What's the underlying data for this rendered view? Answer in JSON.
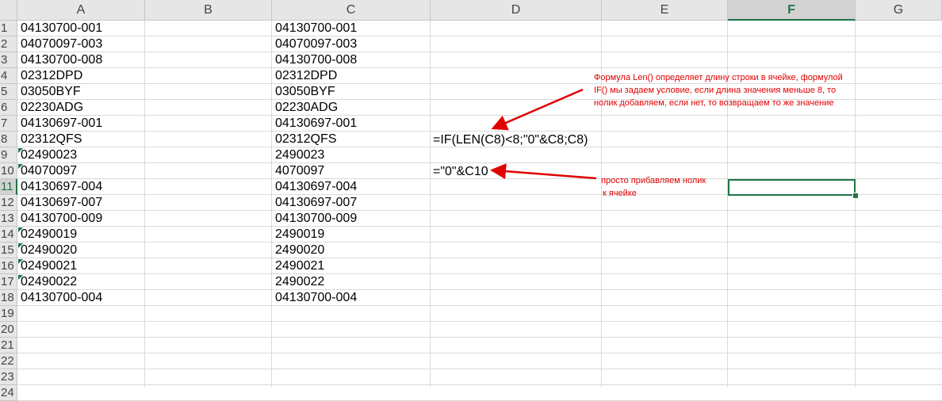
{
  "columns": [
    "A",
    "B",
    "C",
    "D",
    "E",
    "F",
    "G"
  ],
  "selected_column": "F",
  "row_numbers": [
    "1",
    "2",
    "3",
    "4",
    "5",
    "6",
    "7",
    "8",
    "9",
    "10",
    "11",
    "12",
    "13",
    "14",
    "15",
    "16",
    "17",
    "18",
    "19",
    "20",
    "21",
    "22",
    "23",
    "24"
  ],
  "selected_row": "11",
  "column_a": [
    "04130700-001",
    "04070097-003",
    "04130700-008",
    "02312DPD",
    "03050BYF",
    "02230ADG",
    "04130697-001",
    "02312QFS",
    "02490023",
    "04070097",
    "04130697-004",
    "04130697-007",
    "04130700-009",
    "02490019",
    "02490020",
    "02490021",
    "02490022",
    "04130700-004"
  ],
  "column_c": [
    "04130700-001",
    "04070097-003",
    "04130700-008",
    "02312DPD",
    "03050BYF",
    "02230ADG",
    "04130697-001",
    "02312QFS",
    "2490023",
    "4070097",
    "04130697-004",
    "04130697-007",
    "04130700-009",
    "2490019",
    "2490020",
    "2490021",
    "2490022",
    "04130700-004"
  ],
  "formulas": {
    "d8": "=IF(LEN(C8)<8;\"0\"&C8;C8)",
    "d10": "=\"0\"&C10"
  },
  "notes": {
    "len_note": [
      "Формула Len() определяет длину строки в ячейке, формулой",
      "IF() мы задаем условие, если длина значения меньше 8, то",
      "нолик добавляем, если нет, то возвращаем то же значение"
    ],
    "zero_note": [
      "просто прибавляем нолик",
      "к ячейке"
    ]
  },
  "colors": {
    "accent": "#217346",
    "annotation": "#e00000"
  }
}
